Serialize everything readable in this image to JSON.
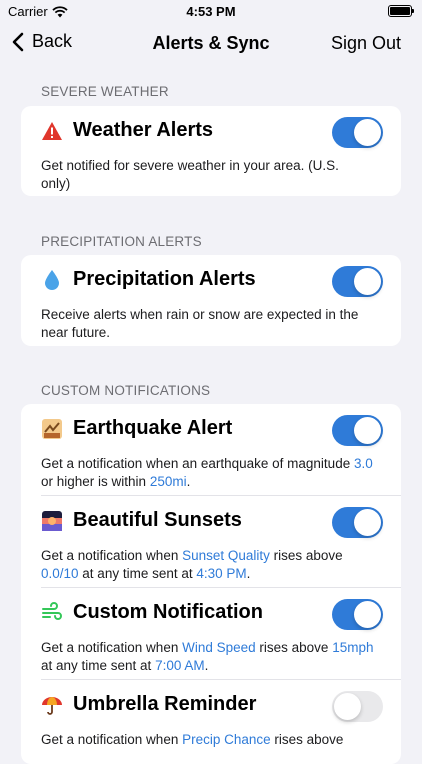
{
  "status": {
    "carrier": "Carrier",
    "time": "4:53 PM"
  },
  "nav": {
    "back": "Back",
    "title": "Alerts & Sync",
    "sign_out": "Sign Out"
  },
  "colors": {
    "accent": "#2f7bd8",
    "background": "#f2f2f7",
    "toggle_off": "#e9e9eb"
  },
  "sections": [
    {
      "header": "SEVERE WEATHER",
      "rows": [
        {
          "icon": "warning-icon",
          "title": "Weather Alerts",
          "enabled": true,
          "desc": [
            "Get notified for severe weather in your area. (U.S. only)"
          ]
        }
      ]
    },
    {
      "header": "PRECIPITATION ALERTS",
      "rows": [
        {
          "icon": "droplet-icon",
          "title": "Precipitation Alerts",
          "enabled": true,
          "desc": [
            "Receive alerts when rain or snow are expected in the near future."
          ]
        }
      ]
    },
    {
      "header": "CUSTOM NOTIFICATIONS",
      "rows": [
        {
          "icon": "earthquake-icon",
          "title": "Earthquake Alert",
          "enabled": true,
          "desc": [
            "Get a notification when an earthquake of magnitude ",
            "3.0",
            " or higher is within ",
            "250mi",
            "."
          ]
        },
        {
          "icon": "sunset-icon",
          "title": "Beautiful Sunsets",
          "enabled": true,
          "desc": [
            "Get a notification when ",
            "Sunset Quality",
            " rises above ",
            "0.0/10",
            " at any time sent at ",
            "4:30 PM",
            "."
          ]
        },
        {
          "icon": "wind-icon",
          "title": "Custom Notification",
          "enabled": true,
          "desc": [
            "Get a notification when ",
            "Wind Speed",
            " rises above ",
            "15mph",
            " at any time sent at ",
            "7:00 AM",
            "."
          ]
        },
        {
          "icon": "umbrella-icon",
          "title": "Umbrella Reminder",
          "enabled": false,
          "desc": [
            "Get a notification when ",
            "Precip Chance",
            " rises above"
          ]
        }
      ]
    }
  ]
}
